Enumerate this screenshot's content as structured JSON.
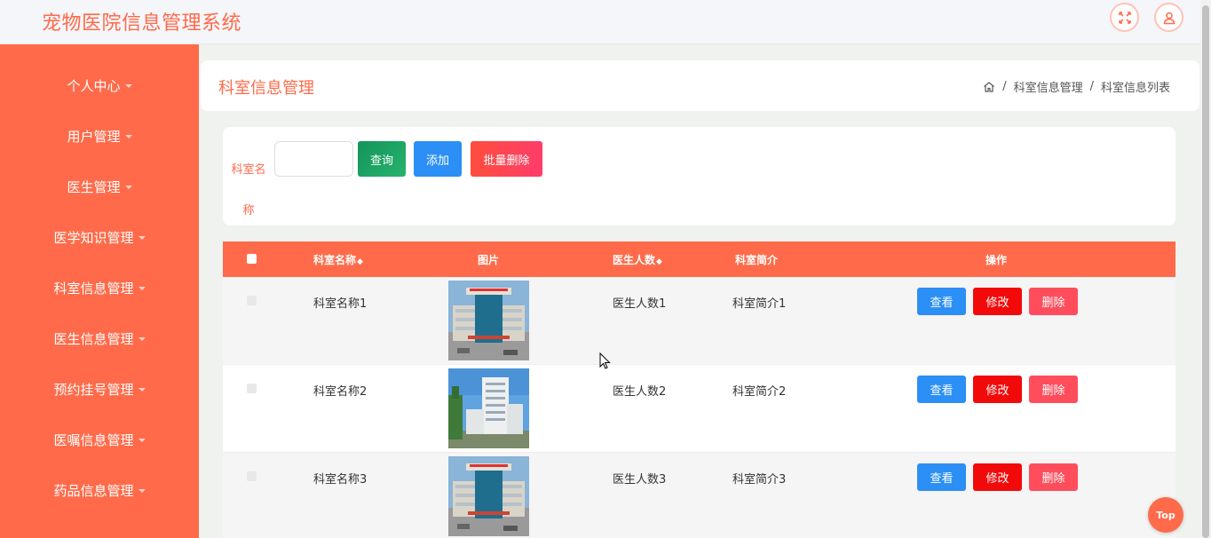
{
  "app": {
    "title": "宠物医院信息管理系统"
  },
  "sidebar": {
    "items": [
      {
        "label": "个人中心"
      },
      {
        "label": "用户管理"
      },
      {
        "label": "医生管理"
      },
      {
        "label": "医学知识管理"
      },
      {
        "label": "科室信息管理"
      },
      {
        "label": "医生信息管理"
      },
      {
        "label": "预约挂号管理"
      },
      {
        "label": "医嘱信息管理"
      },
      {
        "label": "药品信息管理"
      }
    ]
  },
  "page": {
    "title": "科室信息管理",
    "breadcrumb": [
      "科室信息管理",
      "科室信息列表"
    ],
    "separator": "/"
  },
  "search": {
    "label": "科室名称",
    "value": "",
    "query_label": "查询",
    "add_label": "添加",
    "batch_delete_label": "批量删除"
  },
  "table": {
    "columns": {
      "name": "科室名称",
      "image": "图片",
      "doctors": "医生人数",
      "intro": "科室简介",
      "actions": "操作"
    },
    "sort_glyph": "◆",
    "rows": [
      {
        "name": "科室名称1",
        "doctors": "医生人数1",
        "intro": "科室简介1",
        "view": "查看",
        "edit": "修改",
        "delete": "删除"
      },
      {
        "name": "科室名称2",
        "doctors": "医生人数2",
        "intro": "科室简介2",
        "view": "查看",
        "edit": "修改",
        "delete": "删除"
      },
      {
        "name": "科室名称3",
        "doctors": "医生人数3",
        "intro": "科室简介3",
        "view": "查看",
        "edit": "修改",
        "delete": "删除"
      }
    ]
  },
  "top_button": {
    "label": "Top"
  },
  "colors": {
    "accent": "#ff6b4a",
    "primary": "#2b8ff5",
    "danger": "#f20a0a",
    "success": "#14945a"
  }
}
